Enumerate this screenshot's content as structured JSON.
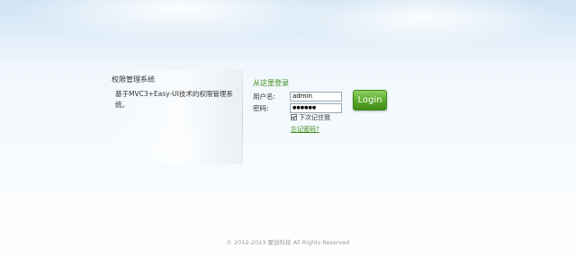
{
  "system": {
    "title": "权限管理系统",
    "description": "基于MVC3+Easy-UI技术的权限管理系统。"
  },
  "login": {
    "title": "从这里登录",
    "username_label": "用户名:",
    "username_value": "admin",
    "password_label": "密码:",
    "password_value": "●●●●●●",
    "remember_label": "下次记住我",
    "remember_checked": true,
    "forgot_link": "忘记密码?",
    "button_label": "Login"
  },
  "footer": {
    "copyright": "© 2012-2013 聚创科技 All Rights Reserved"
  },
  "colors": {
    "accent_green": "#3a8a12",
    "button_green": "#58a72a"
  }
}
